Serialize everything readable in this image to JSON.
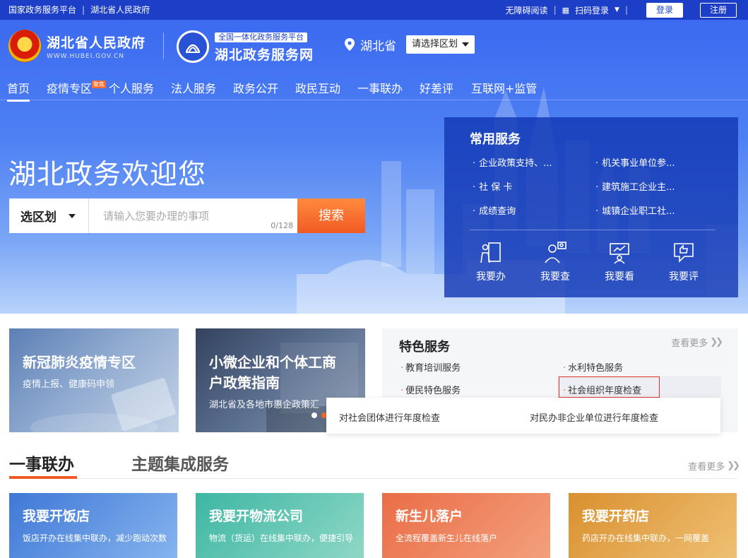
{
  "topbar": {
    "link1": "国家政务服务平台",
    "link2": "湖北省人民政府",
    "accessibility": "无障碍阅读",
    "scan_login": "扫码登录",
    "login": "登录",
    "register": "注册"
  },
  "header": {
    "gov_name": "湖北省人民政府",
    "gov_url": "WWW.HUBEI.GOV.CN",
    "platform_tag": "全国一体化政务服务平台",
    "platform_name": "湖北政务服务网",
    "province": "湖北省",
    "region_select": "请选择区划"
  },
  "nav": {
    "items": [
      "首页",
      "疫情专区",
      "个人服务",
      "法人服务",
      "政务公开",
      "政民互动",
      "一事联办",
      "好差评",
      "互联网+监管"
    ],
    "hot_badge": "聚焦"
  },
  "hero": {
    "welcome": "湖北政务欢迎您",
    "area_select": "选区划",
    "search_placeholder": "请输入您要办理的事项",
    "counter": "0/128",
    "search_button": "搜索"
  },
  "common_services": {
    "title": "常用服务",
    "items": [
      "企业政策支持、...",
      "机关事业单位参...",
      "社 保 卡",
      "建筑施工企业主...",
      "成绩查询",
      "城镇企业职工社..."
    ],
    "actions": [
      "我要办",
      "我要查",
      "我要看",
      "我要评"
    ]
  },
  "cards": {
    "covid_title": "新冠肺炎疫情专区",
    "covid_sub": "疫情上报、健康码申领",
    "sme_title_line1": "小微企业和个体工商",
    "sme_title_line2": "户政策指南",
    "sme_sub": "湖北省及各地市惠企政策汇"
  },
  "featured": {
    "title": "特色服务",
    "more": "查看更多",
    "items": [
      "教育培训服务",
      "水利特色服务",
      "便民特色服务",
      "社会组织年度检查"
    ],
    "popup": [
      "对社会团体进行年度检查",
      "对民办非企业单位进行年度检查"
    ]
  },
  "tabs": {
    "active": "一事联办",
    "inactive": "主题集成服务",
    "more": "查看更多"
  },
  "themes": [
    {
      "title": "我要开饭店",
      "desc": "饭店开办在线集中联办，减少跑动次数"
    },
    {
      "title": "我要开物流公司",
      "desc": "物流（货运）在线集中联办，便捷引导"
    },
    {
      "title": "新生儿落户",
      "desc": "全流程覆盖新生儿在线落户"
    },
    {
      "title": "我要开药店",
      "desc": "药店开办在线集中联办，一网覆盖"
    }
  ],
  "colors": {
    "brand_blue": "#1d3fc7",
    "accent_orange": "#f15a24",
    "highlight_red": "#e0302a"
  }
}
